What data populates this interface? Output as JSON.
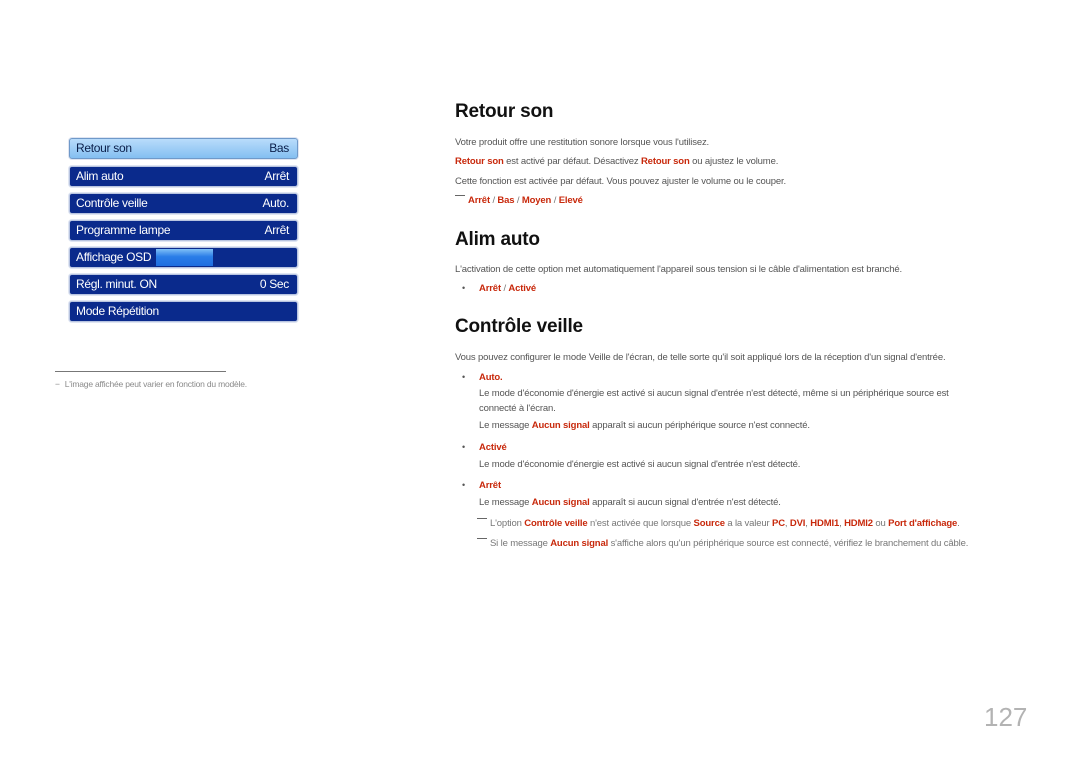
{
  "osd_menu": {
    "items": [
      {
        "label": "Retour son",
        "value": "Bas",
        "selected": true
      },
      {
        "label": "Alim auto",
        "value": "Arrêt",
        "selected": false
      },
      {
        "label": "Contrôle veille",
        "value": "Auto.",
        "selected": false
      },
      {
        "label": "Programme lampe",
        "value": "Arrêt",
        "selected": false
      },
      {
        "label": "Affichage OSD",
        "value": "",
        "selected": false
      },
      {
        "label": "Régl. minut. ON",
        "value": "0 Sec",
        "selected": false
      },
      {
        "label": "Mode Répétition",
        "value": "",
        "selected": false
      }
    ],
    "colors": {
      "item_bg": "#0a2a8c",
      "selected_bg": "#a0cdf6",
      "highlight": "#2a7de8"
    }
  },
  "footnote": {
    "dash": "−",
    "text": "L'image affichée peut varier en fonction du modèle."
  },
  "sections": {
    "retour_son": {
      "title": "Retour son",
      "p1": "Votre produit offre une restitution sonore lorsque vous l'utilisez.",
      "p2_a": "Retour son",
      "p2_b": " est activé par défaut. Désactivez ",
      "p2_c": "Retour son",
      "p2_d": " ou ajustez le volume.",
      "p3": "Cette fonction est activée par défaut. Vous pouvez ajuster le volume ou le couper.",
      "options": [
        "Arrêt",
        "Bas",
        "Moyen",
        "Elevé"
      ],
      "separator": " / "
    },
    "alim_auto": {
      "title": "Alim auto",
      "p1": "L'activation de cette option met automatiquement l'appareil sous tension si le câble d'alimentation est branché.",
      "bullet": "•",
      "options": [
        "Arrêt",
        "Activé"
      ],
      "separator": " / "
    },
    "controle_veille": {
      "title": "Contrôle veille",
      "p1": "Vous pouvez configurer le mode Veille de l'écran, de telle sorte qu'il soit appliqué lors de la réception d'un signal d'entrée.",
      "bullet": "•",
      "auto": {
        "label": "Auto.",
        "line1": "Le mode d'économie d'énergie est activé si aucun signal d'entrée n'est détecté, même si un périphérique source est",
        "line2": "connecté à l'écran.",
        "msg_a": "Le message ",
        "msg_b": "Aucun signal",
        "msg_c": " apparaît si aucun périphérique source n'est connecté."
      },
      "active": {
        "label": "Activé",
        "line1": "Le mode d'économie d'énergie est activé si aucun signal d'entrée n'est détecté."
      },
      "off": {
        "label": "Arrêt",
        "msg_a": "Le message ",
        "msg_b": "Aucun signal",
        "msg_c": " apparaît si aucun signal d'entrée n'est détecté."
      },
      "note1": {
        "a": "L'option ",
        "b": "Contrôle veille",
        "c": " n'est activée que lorsque ",
        "d": "Source",
        "e": " a la valeur ",
        "f": "PC",
        "g": ", ",
        "h": "DVI",
        "i": ", ",
        "j": "HDMI1",
        "k": ", ",
        "l": "HDMI2",
        "m": " ou ",
        "n": "Port d'affichage",
        "o": "."
      },
      "note2": {
        "a": "Si le message ",
        "b": "Aucun signal",
        "c": " s'affiche alors qu'un périphérique source est connecté, vérifiez le branchement du câble."
      }
    }
  },
  "page_number": "127",
  "accent_color": "#c8290c"
}
